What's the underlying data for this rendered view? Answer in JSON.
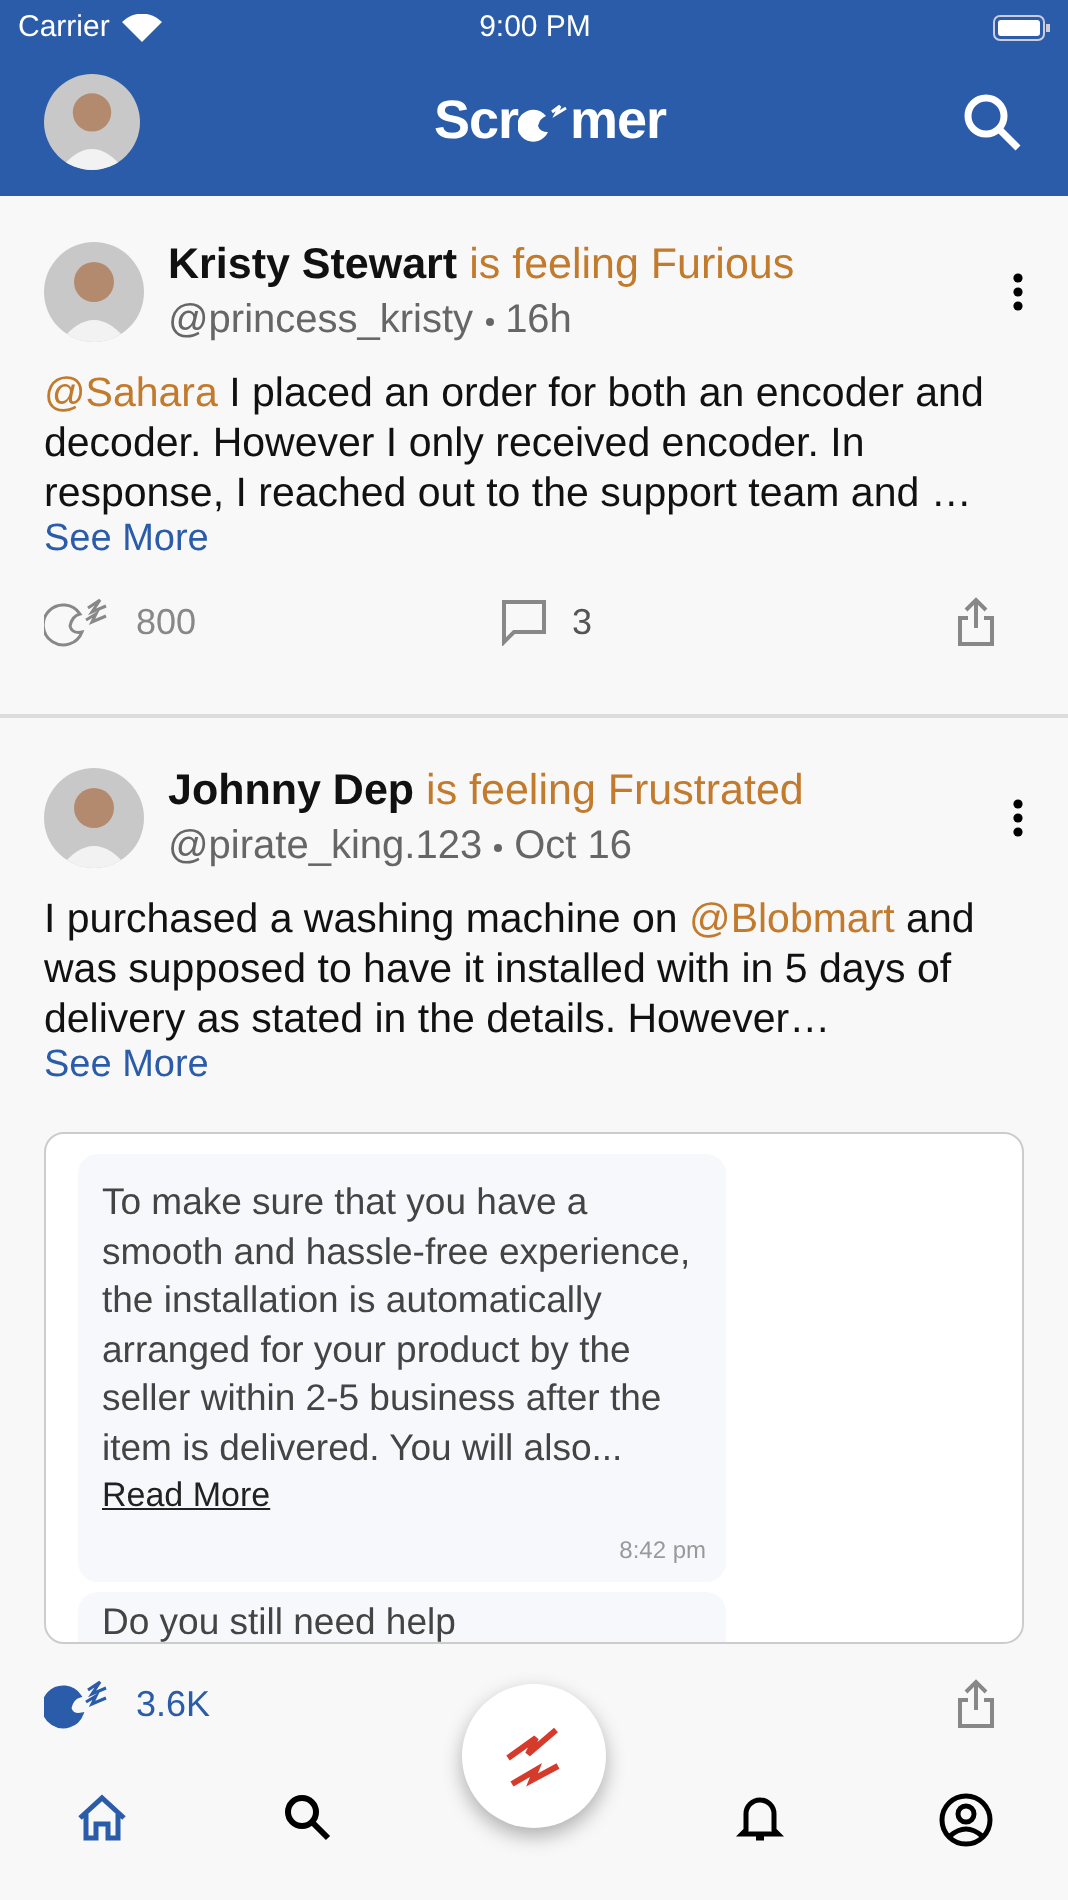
{
  "status_bar": {
    "carrier": "Carrier",
    "time": "9:00 PM"
  },
  "header": {
    "logo_start": "Scr",
    "logo_end": "mer"
  },
  "posts": [
    {
      "name": "Kristy Stewart",
      "feeling": "is feeling Furious",
      "handle": "@princess_kristy",
      "time": "16h",
      "body": [
        {
          "text": "@Sahara",
          "mention": true
        },
        {
          "text": " I placed an order for both an encoder and decoder. However I only received encoder. In response, I reached out to the support team and …",
          "mention": false
        }
      ],
      "see_more": "See More",
      "reactions": "800",
      "reacted": false,
      "comments": "3"
    },
    {
      "name": "Johnny Dep",
      "feeling": "is feeling Frustrated",
      "handle": "@pirate_king.123",
      "time": "Oct 16",
      "body": [
        {
          "text": "I purchased a washing machine on ",
          "mention": false
        },
        {
          "text": "@Blobmart",
          "mention": true
        },
        {
          "text": " and was supposed to have it installed with in 5 days of delivery as stated in the details. However…",
          "mention": false
        }
      ],
      "see_more": "See More",
      "attachment": {
        "message": "To make sure that you have a smooth and hassle-free experience, the installation is automatically arranged for your product by the seller within 2-5 business after the item is delivered. You will also...",
        "link": "Read More",
        "time": "8:42 pm",
        "next_message": "Do you still need help"
      },
      "reactions": "3.6K",
      "reacted": true
    }
  ],
  "tab_bar": [
    {
      "kind": "home",
      "selected": true
    },
    {
      "kind": "search",
      "selected": false
    },
    {
      "kind": "post",
      "selected": false
    },
    {
      "kind": "notifications",
      "selected": false
    },
    {
      "kind": "profile",
      "selected": false
    }
  ]
}
